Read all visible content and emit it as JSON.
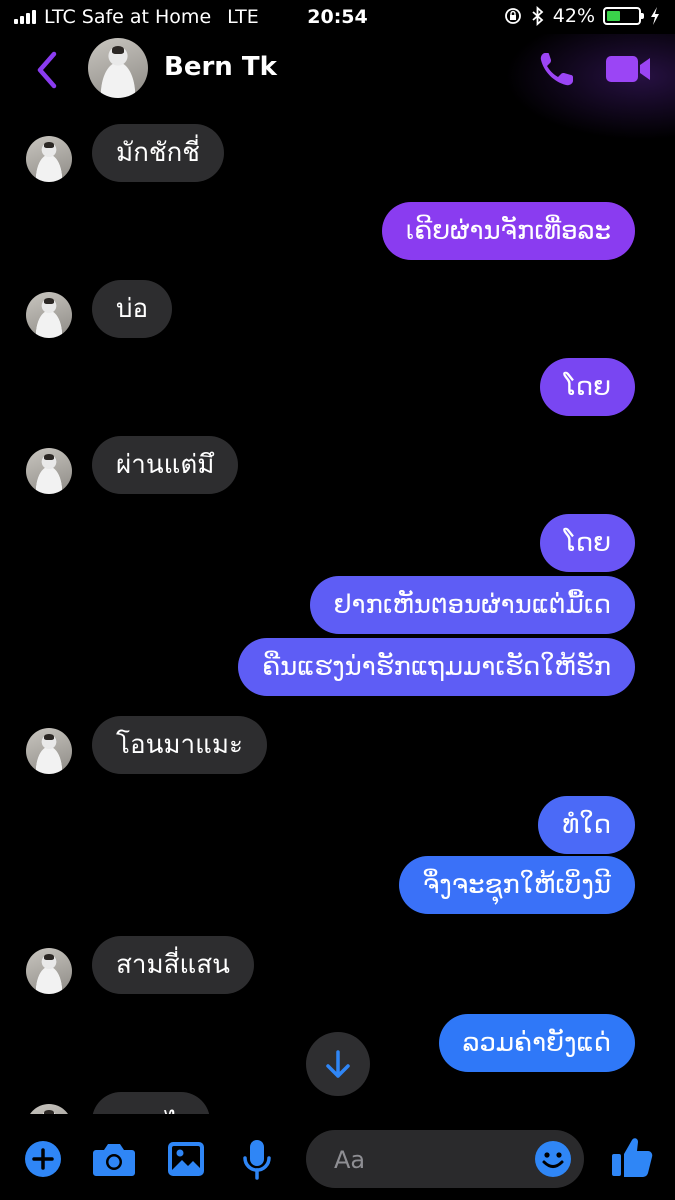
{
  "status_bar": {
    "carrier": "LTC Safe at Home",
    "network": "LTE",
    "time": "20:54",
    "battery": "42%",
    "battery_level": 0.42
  },
  "header": {
    "contact_name": "Bern Tk",
    "accent_color": "#8a3cf0"
  },
  "messages": [
    {
      "side": "in",
      "text": "มักชักชี่"
    },
    {
      "side": "out",
      "text": "เຄີຍຜ່ານຈັກເທື່ອລະ"
    },
    {
      "side": "in",
      "text": "บ่อ"
    },
    {
      "side": "out",
      "text": "ໂດຍ"
    },
    {
      "side": "in",
      "text": "ผ่านแต่มึ"
    },
    {
      "side": "out",
      "text": "ໂດຍ"
    },
    {
      "side": "out",
      "text": "ຢາກເຫັນຕອນຜ່ານແຕ່ມື້ເດ"
    },
    {
      "side": "out",
      "text": "ຄືນແຮງນ່າຮັກແຖມມາເຮັດໃຫ້ຮັກ"
    },
    {
      "side": "in",
      "text": "โอนมาแมะ"
    },
    {
      "side": "out",
      "text": "ທໍໃດ"
    },
    {
      "side": "out",
      "text": "ຈຶ່ງຈະຊຸກໃຫ້ເບິ່ງນີ"
    },
    {
      "side": "in",
      "text": "สามสี่แสน"
    },
    {
      "side": "out",
      "text": "ລວມຄ່າຍັງແດ່"
    },
    {
      "side": "in",
      "text": "แบบไล"
    }
  ],
  "composer": {
    "placeholder": "Aa",
    "icons": [
      "plus-icon",
      "camera-icon",
      "image-icon",
      "microphone-icon",
      "emoji-icon",
      "thumbs-up-icon"
    ],
    "icon_color": "#2f86f6"
  }
}
